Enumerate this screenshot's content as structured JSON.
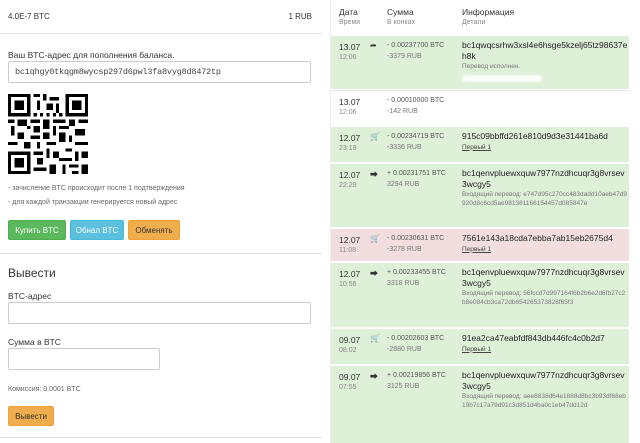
{
  "balance": {
    "btc": "4.0E-7 BTC",
    "rub": "1 RUB"
  },
  "deposit": {
    "label": "Ваш BTC-адрес для пополнения баланса.",
    "address": "bc1qhgy0tkqgm8wycsp297d6pwl3fa8vyg8d8472tp",
    "notes": [
      "- зачисление BTC происходит после 1 подтверждения",
      "- для каждой транзакции генерируется новый адрес"
    ],
    "buttons": {
      "buy": "Купить BTC",
      "exchange": "Обнал BTC",
      "swap": "Обменять"
    }
  },
  "withdraw": {
    "title": "Вывести",
    "address_label": "BTC-адрес",
    "amount_label": "Сумма в BTC",
    "commission": "Комиссия: 0.0001 BTC",
    "button": "Вывести"
  },
  "table": {
    "headers": {
      "date": "Дата",
      "date_sub": "Время",
      "amount": "Сумма",
      "amount_sub": "В конках",
      "info": "Информация",
      "info_sub": "Детали"
    },
    "rows": [
      {
        "date": "13.07",
        "time": "12:06",
        "icon": "arrow-out-icon",
        "btc": "- 0.00237700 BTC",
        "rub": "-3379 RUB",
        "info": "bc1qwqcsrhw3xsl4e6hsge5kzelj65tz98637eh8k",
        "sub": "Перевод исполнен.",
        "sub_u": false,
        "color": "green"
      },
      {
        "date": "13.07",
        "time": "12:06",
        "icon": "",
        "btc": "- 0.00010000 BTC",
        "rub": "-142 RUB",
        "info": "",
        "sub": "",
        "sub_u": false,
        "color": "white"
      },
      {
        "date": "12.07",
        "time": "23:19",
        "icon": "cart-icon",
        "btc": "- 0.00234719 BTC",
        "rub": "-3336 RUB",
        "info": "915c09bbffd261e810d9d3e31441ba6d",
        "sub": "Первый 1",
        "sub_u": true,
        "color": "green"
      },
      {
        "date": "12.07",
        "time": "22:29",
        "icon": "arrow-in-icon",
        "btc": "+ 0.00231751 BTC",
        "rub": "3294 RUB",
        "info": "bc1qenvpluewxquw7977nzdhcuqr3g8vrsev3wcgy5",
        "sub": "Входящий перевод: e747d95c270cc483dadd10aeb47d9920d8c6cd5ae981381166154457d085847e",
        "sub_u": false,
        "color": "green"
      },
      {
        "date": "12.07",
        "time": "11:08",
        "icon": "cart-icon",
        "btc": "- 0.00230631 BTC",
        "rub": "-3278 RUB",
        "info": "7561e143a18cda7ebba7ab15eb2675d4",
        "sub": "Первый 1",
        "sub_u": true,
        "color": "red"
      },
      {
        "date": "12.07",
        "time": "10:56",
        "icon": "arrow-in-icon",
        "btc": "+ 0.00233455 BTC",
        "rub": "3318 RUB",
        "info": "bc1qenvpluewxquw7977nzdhcuqr3g8vrsev3wcgy5",
        "sub": "Входящий перевод: 56fccd7d997164f6b2b6e2d6fb27c2b8e084cb3ca72db654265373828f65f3",
        "sub_u": false,
        "color": "green"
      },
      {
        "date": "09.07",
        "time": "08:02",
        "icon": "cart-icon",
        "btc": "- 0.00202603 BTC",
        "rub": "-2880 RUB",
        "info": "91ea2ca47eabfdf843db446fc4c0b2d7",
        "sub": "Первый 1",
        "sub_u": true,
        "color": "green"
      },
      {
        "date": "09.07",
        "time": "07:55",
        "icon": "arrow-in-icon",
        "btc": "+ 0.00219856 BTC",
        "rub": "3125 RUB",
        "info": "bc1qenvpluewxquw7977nzdhcuqr3g8vrsev3wcgy5",
        "sub": "Входящий перевод: aee8838d64e1888d8bc3b93df68eb19b7c17a79d91c3d851d4ba0c1eb47dd12d",
        "sub_u": false,
        "color": "green"
      }
    ]
  }
}
